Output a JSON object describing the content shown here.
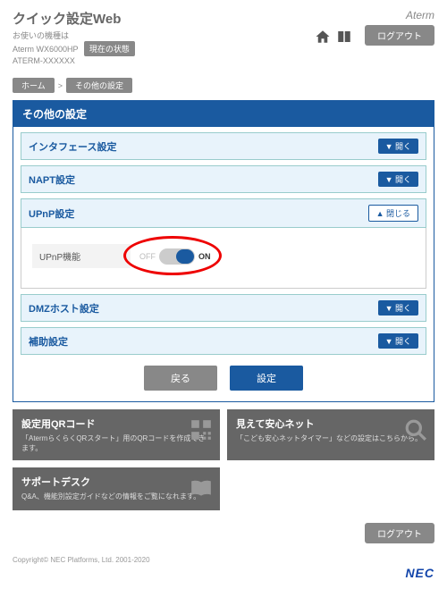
{
  "header": {
    "title": "クイック設定Web",
    "subtitle1": "お使いの機種は",
    "subtitle2": "Aterm WX6000HP",
    "subtitle3": "ATERM-XXXXXX",
    "status_btn": "現在の状態",
    "brand": "Aterm",
    "logout": "ログアウト"
  },
  "crumb": {
    "home": "ホーム",
    "sep": ">",
    "current": "その他の設定"
  },
  "panel": {
    "title": "その他の設定",
    "sections": [
      {
        "label": "インタフェース設定",
        "btn": "▼ 開く",
        "open": false
      },
      {
        "label": "NAPT設定",
        "btn": "▼ 開く",
        "open": false
      },
      {
        "label": "UPnP設定",
        "btn": "▲ 閉じる",
        "open": true,
        "body": {
          "field": "UPnP機能",
          "off": "OFF",
          "on": "ON",
          "state": "on"
        }
      },
      {
        "label": "DMZホスト設定",
        "btn": "▼ 開く",
        "open": false
      },
      {
        "label": "補助設定",
        "btn": "▼ 開く",
        "open": false
      }
    ],
    "back": "戻る",
    "apply": "設定"
  },
  "cards": [
    {
      "title": "設定用QRコード",
      "desc": "「AtermらくらくQRスタート」用のQRコードを作成できます。",
      "icon": "qr"
    },
    {
      "title": "見えて安心ネット",
      "desc": "「こども安心ネットタイマー」などの設定はこちらから。",
      "icon": "search"
    },
    {
      "title": "サポートデスク",
      "desc": "Q&A、機能別設定ガイドなどの情報をご覧になれます。",
      "icon": "book"
    }
  ],
  "footer": {
    "logout": "ログアウト",
    "copyright": "Copyright© NEC Platforms, Ltd. 2001-2020",
    "nec": "NEC"
  }
}
